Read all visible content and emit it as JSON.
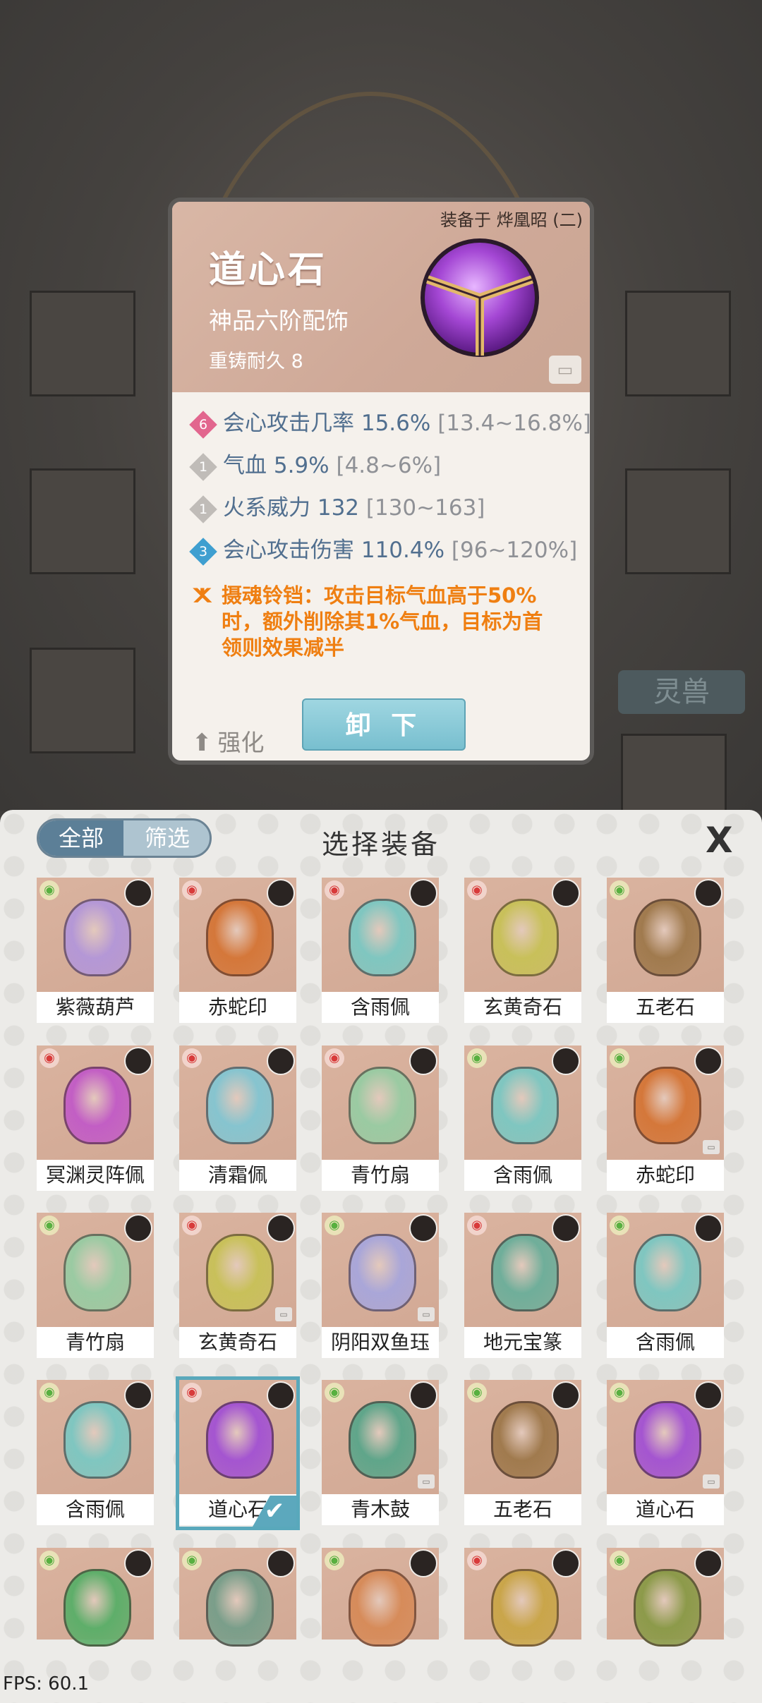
{
  "background": {
    "tag_label": "灵兽"
  },
  "detail": {
    "equipped_on": "装备于 烨凰昭 (二)",
    "name": "道心石",
    "grade": "神品六阶配饰",
    "durability": "重铸耐久 8",
    "stats": [
      {
        "badge": "6",
        "badge_color": "#e2668e",
        "name": "会心攻击几率",
        "value": "15.6%",
        "range": "[13.4~16.8%]"
      },
      {
        "badge": "1",
        "badge_color": "#c0bcb8",
        "name": "气血",
        "value": "5.9%",
        "range": "[4.8~6%]"
      },
      {
        "badge": "1",
        "badge_color": "#c0bcb8",
        "name": "火系威力",
        "value": "132",
        "range": "[130~163]"
      },
      {
        "badge": "3",
        "badge_color": "#3f9fd0",
        "name": "会心攻击伤害",
        "value": "110.4%",
        "range": "[96~120%]"
      }
    ],
    "effect_lines": [
      "摄魂铃铛：攻击目标气血高于50%",
      "时，额外削除其1%气血，目标为首",
      "领则效果减半"
    ],
    "strengthen_label": "强化",
    "unequip_label": "卸 下"
  },
  "panel": {
    "tab_all": "全部",
    "tab_filter": "筛选",
    "title": "选择装备",
    "close": "X"
  },
  "items": [
    {
      "name": "紫薇葫芦",
      "element": "green",
      "color": "#b497d6",
      "lock": false
    },
    {
      "name": "赤蛇印",
      "element": "red",
      "color": "#d4773a",
      "lock": false
    },
    {
      "name": "含雨佩",
      "element": "red",
      "color": "#7fc6c0",
      "lock": false
    },
    {
      "name": "玄黄奇石",
      "element": "red",
      "color": "#c8c05a",
      "lock": false
    },
    {
      "name": "五老石",
      "element": "green",
      "color": "#a07a4e",
      "lock": false
    },
    {
      "name": "冥渊灵阵佩",
      "element": "red",
      "color": "#c25ec4",
      "lock": false
    },
    {
      "name": "清霜佩",
      "element": "red",
      "color": "#86c4cf",
      "lock": false
    },
    {
      "name": "青竹扇",
      "element": "red",
      "color": "#9acaa2",
      "lock": false
    },
    {
      "name": "含雨佩",
      "element": "green",
      "color": "#7fc6c0",
      "lock": false
    },
    {
      "name": "赤蛇印",
      "element": "green",
      "color": "#d4773a",
      "lock": true
    },
    {
      "name": "青竹扇",
      "element": "green",
      "color": "#9acaa2",
      "lock": false
    },
    {
      "name": "玄黄奇石",
      "element": "red",
      "color": "#c8c05a",
      "lock": true
    },
    {
      "name": "阴阳双鱼珏",
      "element": "green",
      "color": "#a9a6d8",
      "lock": true
    },
    {
      "name": "地元宝篆",
      "element": "red",
      "color": "#6fae9a",
      "lock": false
    },
    {
      "name": "含雨佩",
      "element": "green",
      "color": "#7fc6c0",
      "lock": false
    },
    {
      "name": "含雨佩",
      "element": "green",
      "color": "#7fc6c0",
      "lock": false
    },
    {
      "name": "道心石",
      "element": "red",
      "color": "#a455d0",
      "lock": false,
      "selected": true
    },
    {
      "name": "青木鼓",
      "element": "green",
      "color": "#5fa58a",
      "lock": true
    },
    {
      "name": "五老石",
      "element": "green",
      "color": "#a07a4e",
      "lock": false
    },
    {
      "name": "道心石",
      "element": "green",
      "color": "#a455d0",
      "lock": true
    },
    {
      "name": "",
      "element": "green",
      "color": "#5eae6a",
      "lock": false
    },
    {
      "name": "",
      "element": "green",
      "color": "#7a9e8a",
      "lock": false
    },
    {
      "name": "",
      "element": "green",
      "color": "#d68b5a",
      "lock": false
    },
    {
      "name": "",
      "element": "red",
      "color": "#c9a54a",
      "lock": false
    },
    {
      "name": "",
      "element": "green",
      "color": "#8c9a4a",
      "lock": false
    }
  ],
  "fps": "FPS: 60.1"
}
